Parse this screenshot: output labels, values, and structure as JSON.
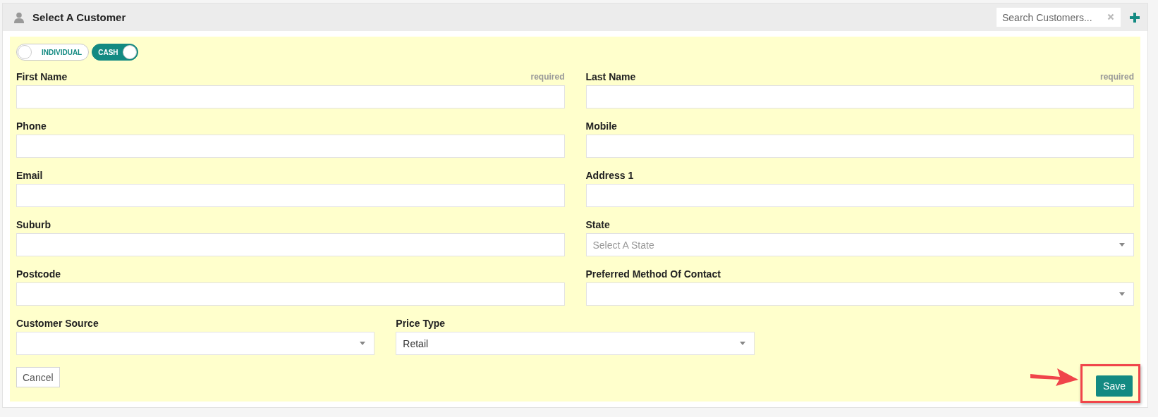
{
  "header": {
    "title": "Select A Customer",
    "search": {
      "placeholder": "Search Customers..."
    }
  },
  "toggles": [
    {
      "label": "INDIVIDUAL",
      "on": false
    },
    {
      "label": "CASH",
      "on": true
    }
  ],
  "rows": [
    [
      {
        "label": "First Name",
        "kind": "text",
        "note": "required"
      },
      {
        "label": "Last Name",
        "kind": "text",
        "note": "required"
      }
    ],
    [
      {
        "label": "Phone",
        "kind": "text"
      },
      {
        "label": "Mobile",
        "kind": "text"
      }
    ],
    [
      {
        "label": "Email",
        "kind": "text"
      },
      {
        "label": "Address 1",
        "kind": "text"
      }
    ],
    [
      {
        "label": "Suburb",
        "kind": "text"
      },
      {
        "label": "State",
        "kind": "select",
        "placeholder": "Select A State"
      }
    ],
    [
      {
        "label": "Postcode",
        "kind": "text"
      },
      {
        "label": "Preferred Method Of Contact",
        "kind": "select"
      }
    ],
    [
      {
        "label": "Customer Source",
        "kind": "select"
      },
      {
        "label": "Price Type",
        "kind": "select",
        "value": "Retail"
      }
    ]
  ],
  "buttons": {
    "cancel": "Cancel",
    "save": "Save"
  }
}
